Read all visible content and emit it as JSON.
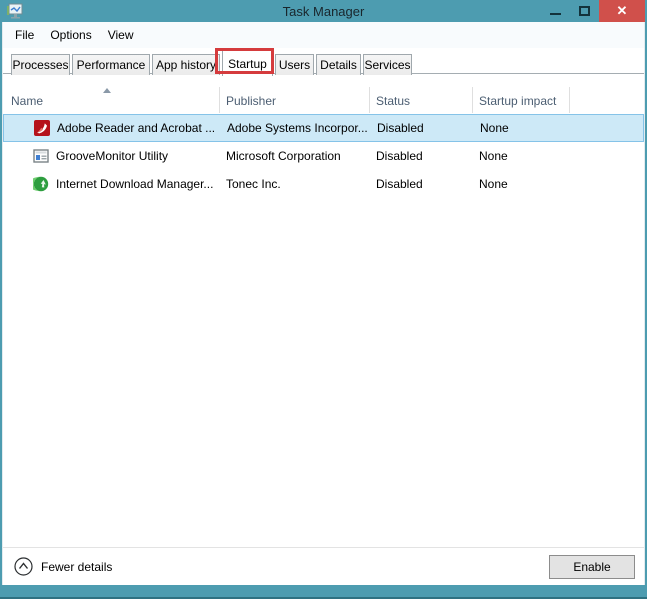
{
  "window": {
    "title": "Task Manager",
    "controls": {
      "close_glyph": "✕"
    }
  },
  "menubar": {
    "items": [
      "File",
      "Options",
      "View"
    ]
  },
  "tabs": {
    "items": [
      "Processes",
      "Performance",
      "App history",
      "Startup",
      "Users",
      "Details",
      "Services"
    ],
    "selected": "Startup",
    "annotation": "red box highlighting Startup tab",
    "annotation_color": "#d53b3d"
  },
  "table": {
    "columns": [
      "Name",
      "Publisher",
      "Status",
      "Startup impact"
    ],
    "sort": {
      "column": "Name",
      "direction": "ascending"
    },
    "rows": [
      {
        "name": "Adobe Reader and Acrobat ...",
        "publisher": "Adobe Systems Incorpor...",
        "status": "Disabled",
        "impact": "None",
        "icon": "adobe-reader-icon",
        "selected": true
      },
      {
        "name": "GrooveMonitor Utility",
        "publisher": "Microsoft Corporation",
        "status": "Disabled",
        "impact": "None",
        "icon": "groove-monitor-icon",
        "selected": false
      },
      {
        "name": "Internet Download Manager...",
        "publisher": "Tonec Inc.",
        "status": "Disabled",
        "impact": "None",
        "icon": "idm-icon",
        "selected": false
      }
    ]
  },
  "footer": {
    "toggle_label": "Fewer details",
    "enable_button_label": "Enable"
  },
  "colors": {
    "titlebar": "#4d9cb0",
    "close_button": "#d0504b",
    "selection_bg": "#cde9f7",
    "selection_border": "#85c3e8",
    "header_text": "#4c5e72",
    "annotation_red": "#d53b3d"
  }
}
